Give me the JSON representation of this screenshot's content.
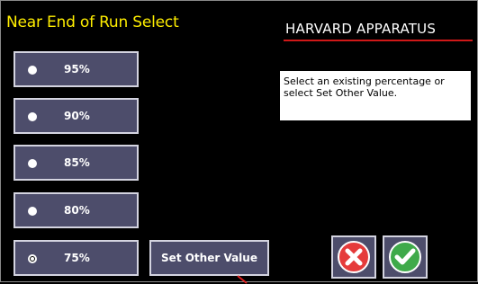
{
  "screen": {
    "title": "Near End of Run Select",
    "brand": "HARVARD APPARATUS",
    "hint": "Select an existing percentage or select Set Other Value."
  },
  "options": [
    {
      "label": "95%",
      "selected": false
    },
    {
      "label": "90%",
      "selected": false
    },
    {
      "label": "85%",
      "selected": false
    },
    {
      "label": "80%",
      "selected": false
    },
    {
      "label": "75%",
      "selected": true
    }
  ],
  "actions": {
    "set_other_label": "Set Other Value",
    "cancel_icon": "cancel-x-icon",
    "confirm_icon": "confirm-check-icon"
  },
  "colors": {
    "title": "#ffee00",
    "button_bg": "#4d4d6b",
    "cancel": "#e53b3b",
    "confirm": "#3faa4a",
    "brand_rule": "#d01818"
  }
}
